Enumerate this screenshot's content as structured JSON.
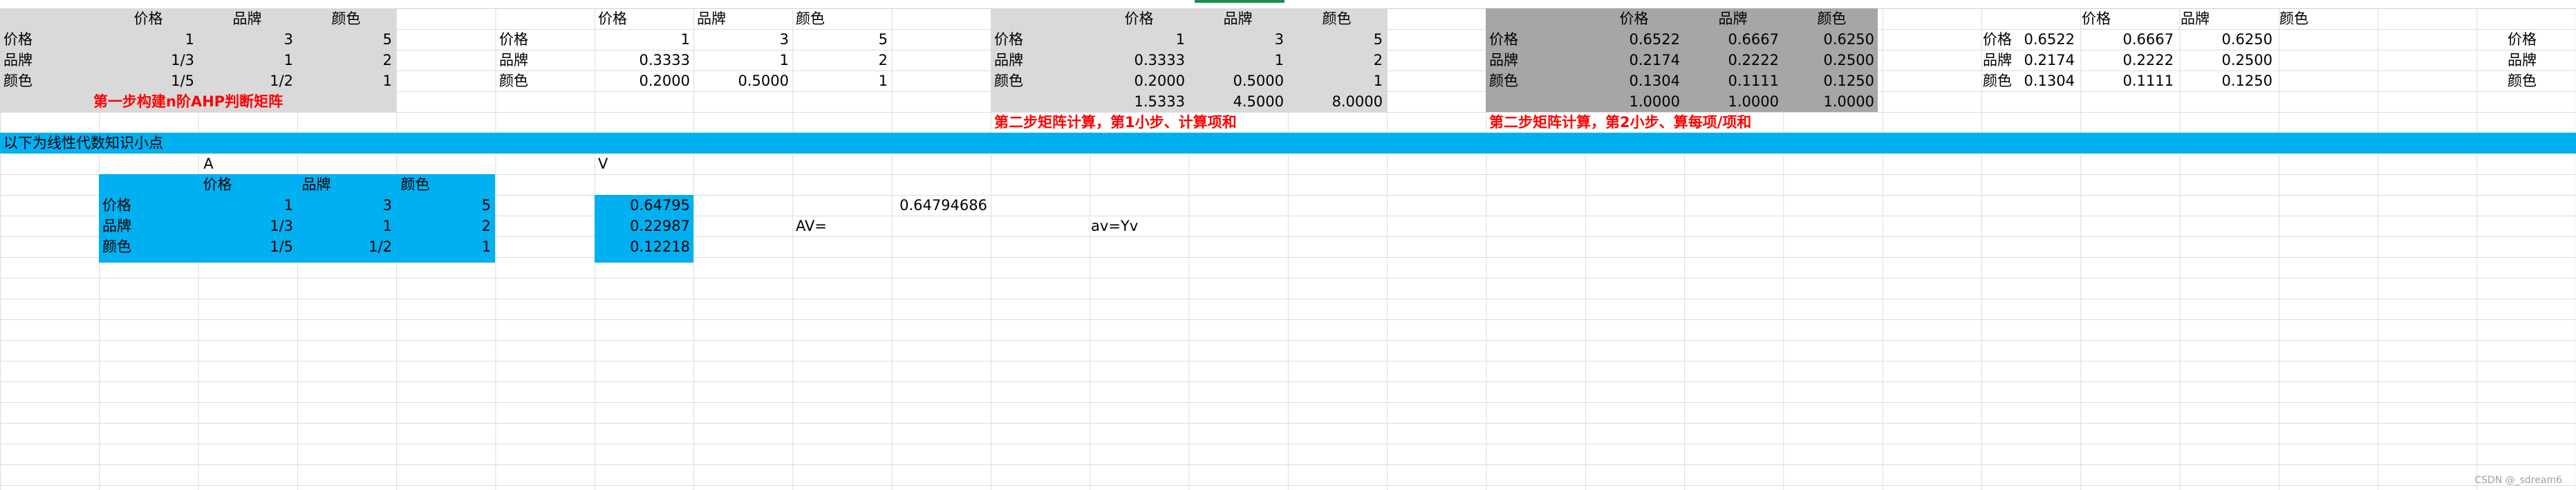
{
  "blockA": {
    "headers": [
      "价格",
      "品牌",
      "颜色"
    ],
    "rows": [
      {
        "label": "价格",
        "values": [
          "1",
          "3",
          "5"
        ]
      },
      {
        "label": "品牌",
        "values": [
          "1/3",
          "1",
          "2"
        ]
      },
      {
        "label": "颜色",
        "values": [
          "1/5",
          "1/2",
          "1"
        ]
      }
    ],
    "note": "第一步构建n阶AHP判断矩阵"
  },
  "blockB": {
    "headers": [
      "价格",
      "品牌",
      "颜色"
    ],
    "rows": [
      {
        "label": "价格",
        "values": [
          "1",
          "3",
          "5"
        ]
      },
      {
        "label": "品牌",
        "values": [
          "0.3333",
          "1",
          "2"
        ]
      },
      {
        "label": "颜色",
        "values": [
          "0.2000",
          "0.5000",
          "1"
        ]
      }
    ]
  },
  "blockC": {
    "headers": [
      "价格",
      "品牌",
      "颜色"
    ],
    "rows": [
      {
        "label": "价格",
        "values": [
          "1",
          "3",
          "5"
        ]
      },
      {
        "label": "品牌",
        "values": [
          "0.3333",
          "1",
          "2"
        ]
      },
      {
        "label": "颜色",
        "values": [
          "0.2000",
          "0.5000",
          "1"
        ]
      }
    ],
    "sums": [
      "1.5333",
      "4.5000",
      "8.0000"
    ],
    "note": "第二步矩阵计算，第1小步、计算项和"
  },
  "blockD": {
    "headers": [
      "价格",
      "品牌",
      "颜色"
    ],
    "rows": [
      {
        "label": "价格",
        "values": [
          "0.6522",
          "0.6667",
          "0.6250"
        ]
      },
      {
        "label": "品牌",
        "values": [
          "0.2174",
          "0.2222",
          "0.2500"
        ]
      },
      {
        "label": "颜色",
        "values": [
          "0.1304",
          "0.1111",
          "0.1250"
        ]
      }
    ],
    "sums": [
      "1.0000",
      "1.0000",
      "1.0000"
    ],
    "note": "第二步矩阵计算，第2小步、算每项/项和"
  },
  "blockE": {
    "headers": [
      "价格",
      "品牌",
      "颜色"
    ],
    "rows": [
      {
        "label": "价格",
        "values": [
          "0.6522",
          "0.6667",
          "0.6250"
        ]
      },
      {
        "label": "品牌",
        "values": [
          "0.2174",
          "0.2222",
          "0.2500"
        ]
      },
      {
        "label": "颜色",
        "values": [
          "0.1304",
          "0.1111",
          "0.1250"
        ]
      }
    ]
  },
  "blockF": {
    "rows": [
      "价格",
      "品牌",
      "颜色"
    ]
  },
  "banner": "以下为线性代数知识小点",
  "lower": {
    "labelA": "A",
    "labelV": "V",
    "headers": [
      "价格",
      "品牌",
      "颜色"
    ],
    "rows": [
      {
        "label": "价格",
        "values": [
          "1",
          "3",
          "5"
        ]
      },
      {
        "label": "品牌",
        "values": [
          "1/3",
          "1",
          "2"
        ]
      },
      {
        "label": "颜色",
        "values": [
          "1/5",
          "1/2",
          "1"
        ]
      }
    ],
    "vector": [
      "0.64795",
      "0.22987",
      "0.12218"
    ],
    "av_label": "AV=",
    "value": "0.64794686",
    "avyv": "av=Yv"
  },
  "watermark": "CSDN @_sdream6",
  "colors": {
    "gray_light": "#d9d9d9",
    "gray_dark": "#a6a6a6",
    "blue": "#00b0f0",
    "red_text": "#ff0000",
    "selection": "#1f8b4c"
  }
}
